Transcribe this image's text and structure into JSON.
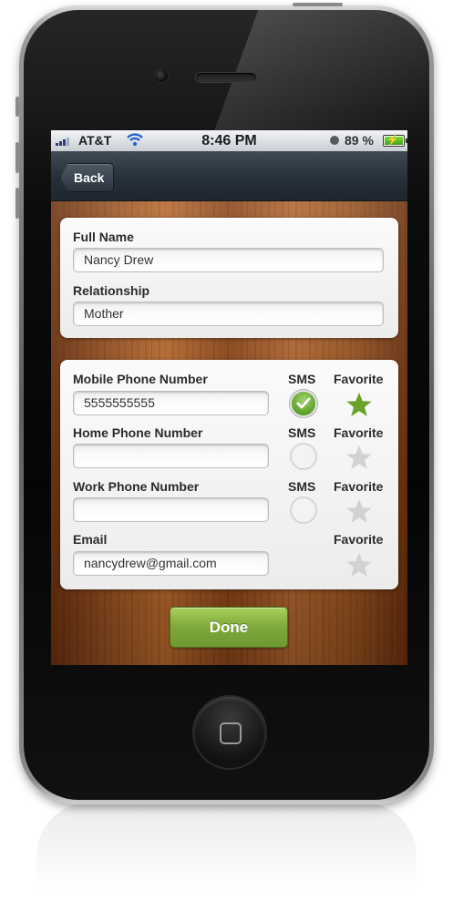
{
  "status_bar": {
    "carrier": "AT&T",
    "time": "8:46 PM",
    "battery_percent": "89 %",
    "battery_level": 0.89
  },
  "nav": {
    "back_label": "Back"
  },
  "profile": {
    "full_name_label": "Full Name",
    "full_name_value": "Nancy Drew",
    "relationship_label": "Relationship",
    "relationship_value": "Mother"
  },
  "contacts": {
    "sms_header": "SMS",
    "favorite_header": "Favorite",
    "rows": [
      {
        "label": "Mobile Phone Number",
        "value": "5555555555",
        "sms": true,
        "favorite": true
      },
      {
        "label": "Home Phone Number",
        "value": "",
        "sms": false,
        "favorite": false
      },
      {
        "label": "Work Phone Number",
        "value": "",
        "sms": false,
        "favorite": false
      },
      {
        "label": "Email",
        "value": "nancydrew@gmail.com",
        "favorite": false
      }
    ]
  },
  "done_label": "Done",
  "colors": {
    "accent_green": "#7ea83b",
    "star_active": "#6aa12b",
    "star_inactive": "#d2d2d2",
    "nav_bar": "#2b343d"
  },
  "icons": {
    "sms_checked": "check-circle-icon",
    "sms_unchecked": "empty-circle-icon",
    "favorite": "star-icon"
  }
}
